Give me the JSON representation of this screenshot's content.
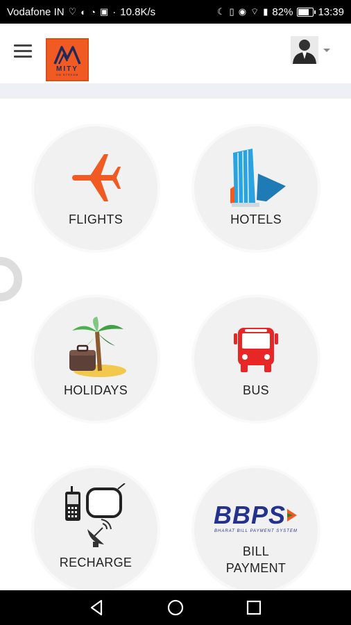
{
  "status_bar": {
    "carrier": "Vodafone IN",
    "speed": "10.8K/s",
    "battery": "82%",
    "battery_level": 0.82,
    "time": "13:39"
  },
  "header": {
    "logo_text": "MITY",
    "logo_subtext": "ON STREAM",
    "menu_icon": "hamburger-icon",
    "avatar_icon": "user-avatar-icon"
  },
  "services": [
    {
      "label": "FLIGHTS",
      "icon": "airplane-icon"
    },
    {
      "label": "HOTELS",
      "icon": "hotel-building-icon"
    },
    {
      "label": "HOLIDAYS",
      "icon": "palm-island-suitcase-icon"
    },
    {
      "label": "BUS",
      "icon": "bus-icon"
    },
    {
      "label": "RECHARGE",
      "icon": "phone-tv-dish-icon"
    },
    {
      "label": "BILL\nPAYMENT",
      "icon": "bbps-logo"
    }
  ],
  "bbps": {
    "logo_text": "BBPS",
    "tagline": "BHARAT BILL PAYMENT SYSTEM"
  },
  "colors": {
    "accent": "#f15a22",
    "bus_red": "#e82626",
    "bbps_blue": "#24328f",
    "tile_bg": "#f1f1f1"
  }
}
